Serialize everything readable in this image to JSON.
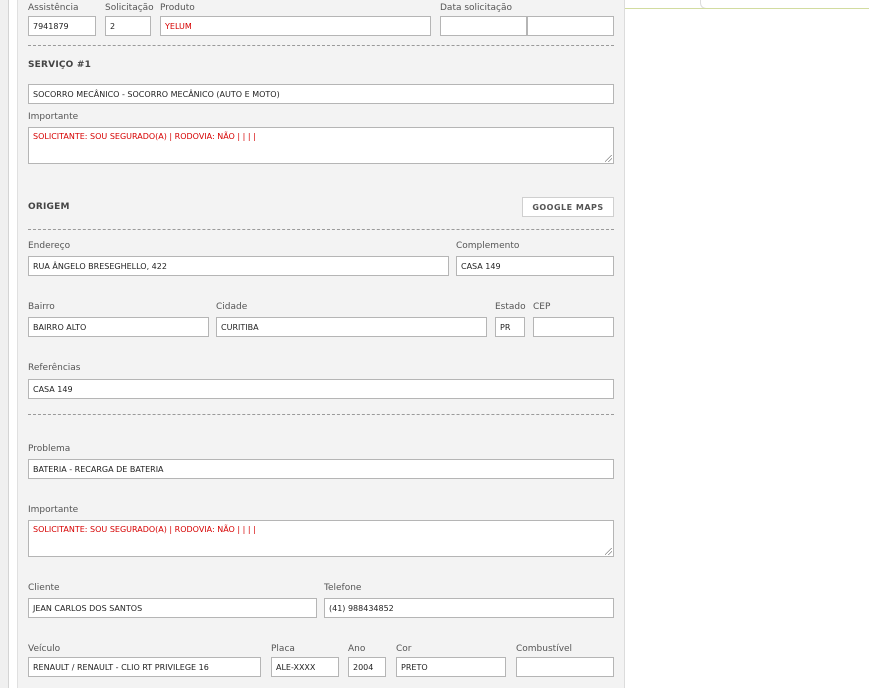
{
  "top_row": {
    "assistencia_label": "Assistência",
    "assistencia_value": "7941879",
    "solicitacao_label": "Solicitação",
    "solicitacao_value": "2",
    "produto_label": "Produto",
    "produto_value": "YELUM",
    "data_solicitacao_label": "Data solicitação",
    "data_value": "",
    "hora_value": ""
  },
  "servico": {
    "title": "SERVIÇO #1",
    "service_value": "SOCORRO MECÂNICO - SOCORRO MECÂNICO (AUTO E MOTO)",
    "importante_label": "Importante",
    "importante_value": "SOLICITANTE: SOU SEGURADO(A) | RODOVIA: NÃO |  |  |  |"
  },
  "origem": {
    "title": "ORIGEM",
    "google_maps_label": "GOOGLE MAPS",
    "endereco_label": "Endereço",
    "endereco_value": "RUA ÂNGELO BRESEGHELLO, 422",
    "complemento_label": "Complemento",
    "complemento_value": "CASA 149",
    "bairro_label": "Bairro",
    "bairro_value": "BAIRRO ALTO",
    "cidade_label": "Cidade",
    "cidade_value": "CURITIBA",
    "estado_label": "Estado",
    "estado_value": "PR",
    "cep_label": "CEP",
    "cep_value": "",
    "referencias_label": "Referências",
    "referencias_value": "CASA 149"
  },
  "problema": {
    "problema_label": "Problema",
    "problema_value": "BATERIA - RECARGA DE BATERIA",
    "importante_label": "Importante",
    "importante_value": "SOLICITANTE: SOU SEGURADO(A) | RODOVIA: NÃO |  |  |  |",
    "cliente_label": "Cliente",
    "cliente_value": "JEAN CARLOS DOS SANTOS",
    "telefone_label": "Telefone",
    "telefone_value": "(41) 988434852",
    "veiculo_label": "Veículo",
    "veiculo_value": "RENAULT / RENAULT - CLIO RT PRIVILEGE 16",
    "placa_label": "Placa",
    "placa_value": "ALE-XXXX",
    "ano_label": "Ano",
    "ano_value": "2004",
    "cor_label": "Cor",
    "cor_value": "PRETO",
    "combustivel_label": "Combustível",
    "combustivel_value": ""
  },
  "colors": {
    "panel_bg": "#f3f3f3",
    "alert_text": "#d60000",
    "input_border": "#b5b5b5"
  }
}
